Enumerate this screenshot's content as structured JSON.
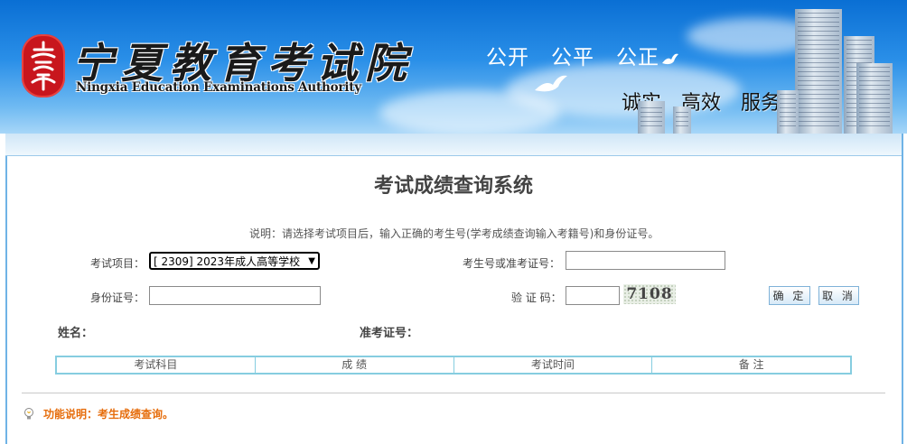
{
  "header": {
    "logo_cn": "宁夏教育考试院",
    "logo_en": "Ningxia Education Examinations Authority",
    "slogan_top": "公开　公平　公正",
    "slogan_bottom": "诚实　高效　服务"
  },
  "page": {
    "title": "考试成绩查询系统",
    "note": "说明：请选择考试项目后，输入正确的考生号(学考成绩查询输入考籍号)和身份证号。"
  },
  "form": {
    "exam_label": "考试项目：",
    "exam_selected": "[ 2309] 2023年成人高等学校",
    "candidate_label": "考生号或准考证号：",
    "candidate_value": "",
    "id_label": "身份证号：",
    "id_value": "",
    "captcha_label": "验 证 码：",
    "captcha_value": "",
    "captcha_text": "7108",
    "confirm_button": "确 定",
    "cancel_button": "取 消"
  },
  "result": {
    "name_label": "姓名：",
    "ticket_label": "准考证号：",
    "columns": [
      "考试科目",
      "成 绩",
      "考试时间",
      "备 注"
    ]
  },
  "footer": {
    "function_note": "功能说明：考生成绩查询。"
  },
  "colors": {
    "banner_blue": "#0a6fd4",
    "accent_orange": "#e66d0c",
    "table_border": "#86cde0"
  }
}
